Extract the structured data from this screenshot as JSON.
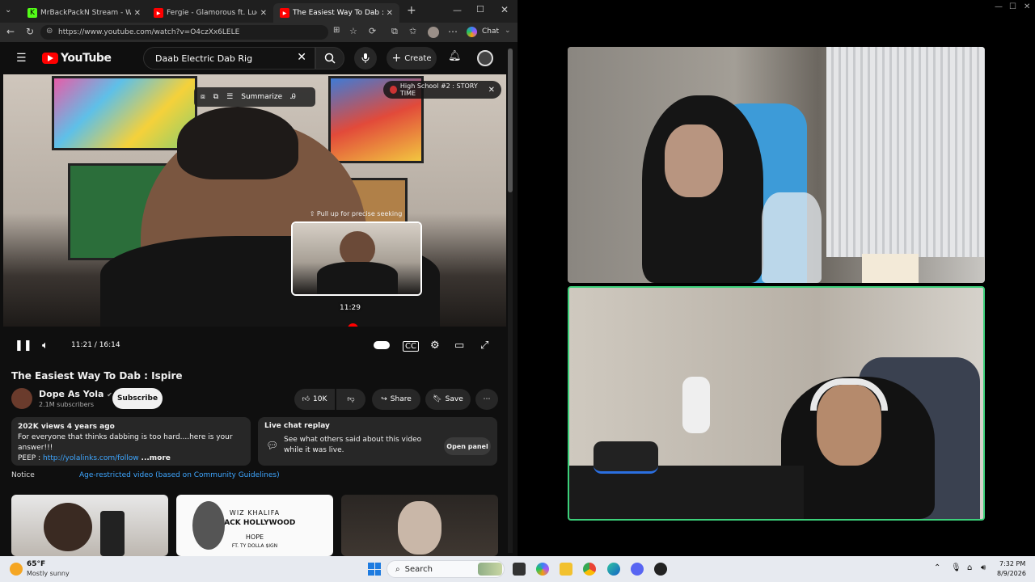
{
  "browser": {
    "tabs": [
      {
        "label": "MrBackPackN Stream - Watc",
        "fav_color": "#53fc18",
        "fav_glyph": "K"
      },
      {
        "label": "Fergie - Glamorous ft. Ludac",
        "fav_color": "#ff0000",
        "fav_glyph": "▶"
      },
      {
        "label": "The Easiest Way To Dab : Isp",
        "fav_color": "#ff0000",
        "fav_glyph": "▶"
      }
    ],
    "url": "https://www.youtube.com/watch?v=O4czXx6LELE",
    "chat_label": "Chat"
  },
  "youtube": {
    "logo": "YouTube",
    "search_value": "Daab Electric Dab Rig",
    "create_label": "Create",
    "player": {
      "summarize_label": "Summarize",
      "story_badge": "High School #2 : STORY TIME",
      "seek_hint": "⇧ Pull up for precise seeking",
      "preview_time": "11:29",
      "time_display": "11:21 / 16:14",
      "progress_fraction": 0.7
    },
    "video": {
      "title": "The Easiest Way To Dab : Ispire",
      "channel": "Dope As Yola",
      "subscribers": "2.1M subscribers",
      "subscribe_label": "Subscribe",
      "likes": "10K",
      "share_label": "Share",
      "save_label": "Save"
    },
    "description": {
      "meta": "202K views  4 years ago",
      "line1": "For everyone that thinks dabbing is too hard....here is your answer!!!",
      "line2_prefix": "PEEP : ",
      "link": "http://yolalinks.com/follow",
      "more": "...more"
    },
    "live_chat": {
      "title": "Live chat replay",
      "text": "See what others said about this video while it was live.",
      "button": "Open panel"
    },
    "notice": {
      "label": "Notice",
      "text": "Age-restricted video (based on Community Guidelines)"
    },
    "thumb2_text": {
      "artist": "WIZ KHALIFA",
      "album": "BLACK HOLLYWOOD",
      "song": "HOPE",
      "feat": "FT. TY DOLLA $IGN"
    }
  },
  "taskbar": {
    "weather_temp": "65°F",
    "weather_desc": "Mostly sunny",
    "search_label": "Search",
    "time": "7:32 PM",
    "date": "8/9/2026"
  }
}
